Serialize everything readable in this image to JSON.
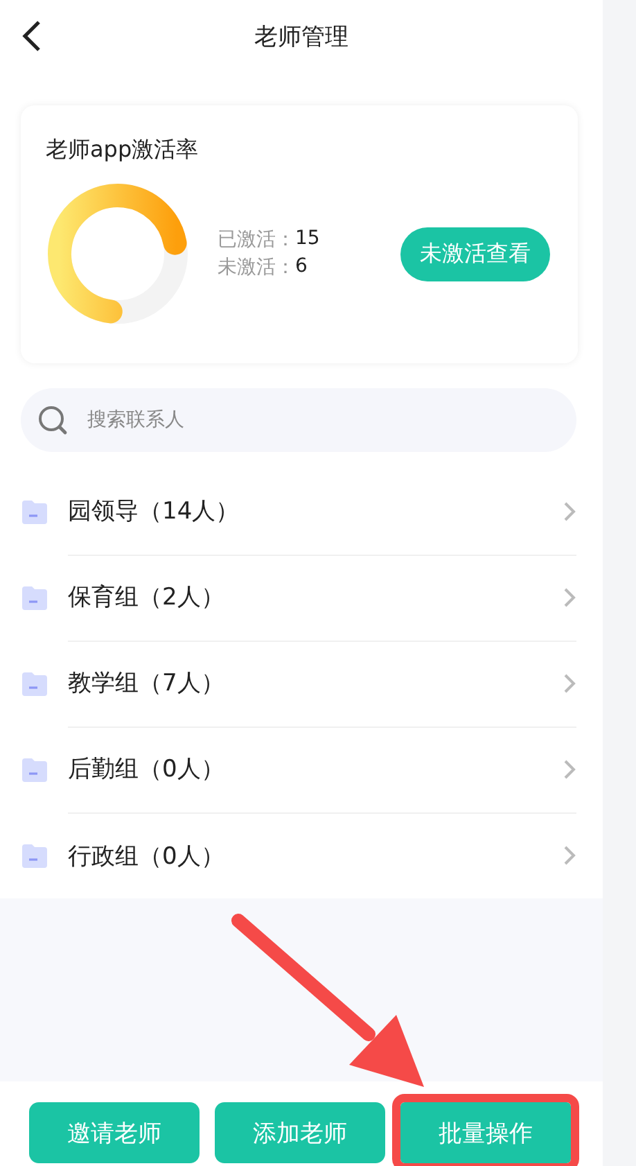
{
  "header": {
    "title": "老师管理"
  },
  "activation_card": {
    "title": "老师app激活率",
    "level": 0.7,
    "stats": [
      {
        "label": "已激活：",
        "value": "15"
      },
      {
        "label": "未激活：",
        "value": "6"
      }
    ],
    "button": "未激活查看"
  },
  "search": {
    "placeholder": "搜索联系人"
  },
  "groups": [
    {
      "label": "园领导（14人）"
    },
    {
      "label": "保育组（2人）"
    },
    {
      "label": "教学组（7人）"
    },
    {
      "label": "后勤组（0人）"
    },
    {
      "label": "行政组（0人）"
    }
  ],
  "buttons": [
    {
      "label": "邀请老师",
      "highlighted": false
    },
    {
      "label": "添加老师",
      "highlighted": false
    },
    {
      "label": "批量操作",
      "highlighted": true
    }
  ]
}
